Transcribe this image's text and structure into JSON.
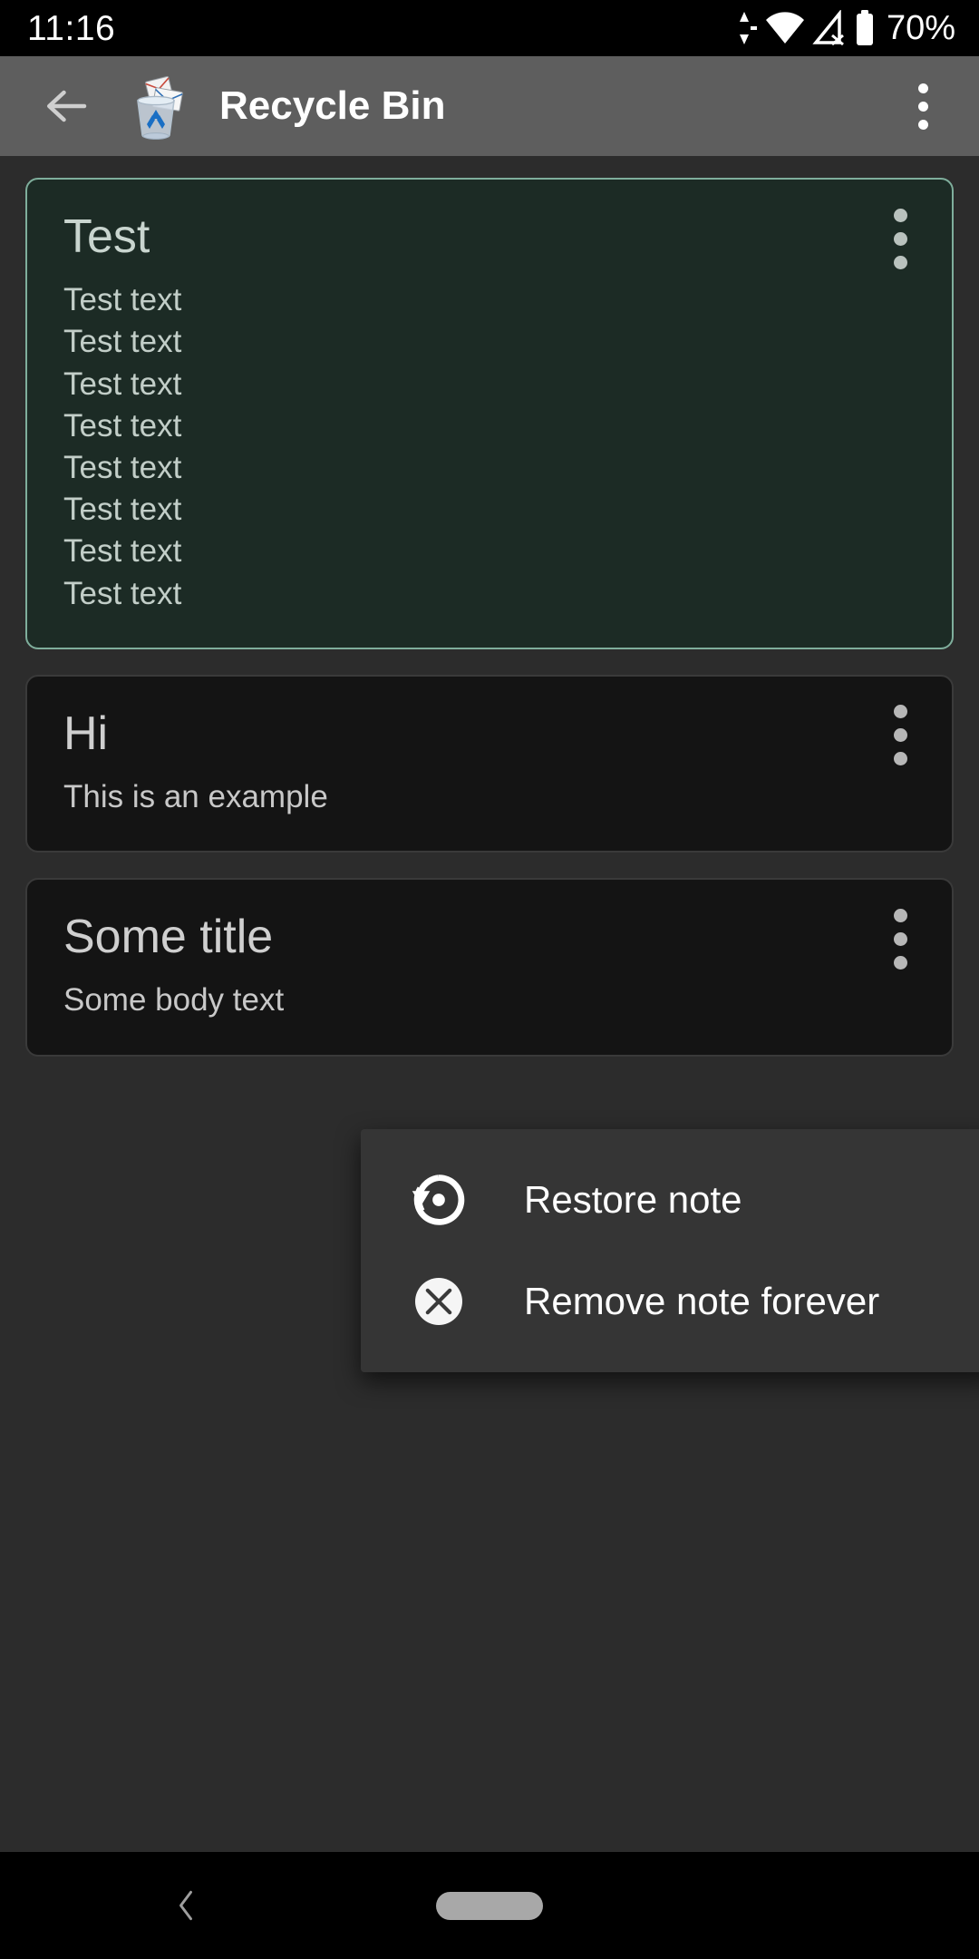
{
  "status_bar": {
    "time": "11:16",
    "battery_percent": "70%",
    "icons": [
      "data-transfer-icon",
      "wifi-icon",
      "signal-off-icon",
      "battery-icon"
    ]
  },
  "app_bar": {
    "back_icon": "arrow-back-icon",
    "app_icon": "recycle-bin-icon",
    "title": "Recycle Bin",
    "overflow_icon": "more-vertical-icon",
    "background_color": "#5e5e5e"
  },
  "notes": [
    {
      "title": "Test",
      "body": "Test text\nTest text\nTest text\nTest text\nTest text\nTest text\nTest text\nTest text",
      "selected": true,
      "background_color": "#1c2b25",
      "border_color": "#7fae9c",
      "overflow_icon": "more-vertical-icon"
    },
    {
      "title": "Hi",
      "body": "This is an example",
      "selected": false,
      "background_color": "#141414",
      "border_color": "#3a3a3a",
      "overflow_icon": "more-vertical-icon"
    },
    {
      "title": "Some title",
      "body": "Some body text",
      "selected": false,
      "background_color": "#141414",
      "border_color": "#3a3a3a",
      "overflow_icon": "more-vertical-icon"
    }
  ],
  "popup_menu": {
    "background_color": "#353535",
    "items": [
      {
        "label": "Restore note",
        "icon": "restore-icon"
      },
      {
        "label": "Remove note forever",
        "icon": "cancel-circle-icon"
      }
    ]
  },
  "nav_bar": {
    "back_icon": "nav-back-chevron-icon",
    "home_icon": "home-pill-icon"
  }
}
